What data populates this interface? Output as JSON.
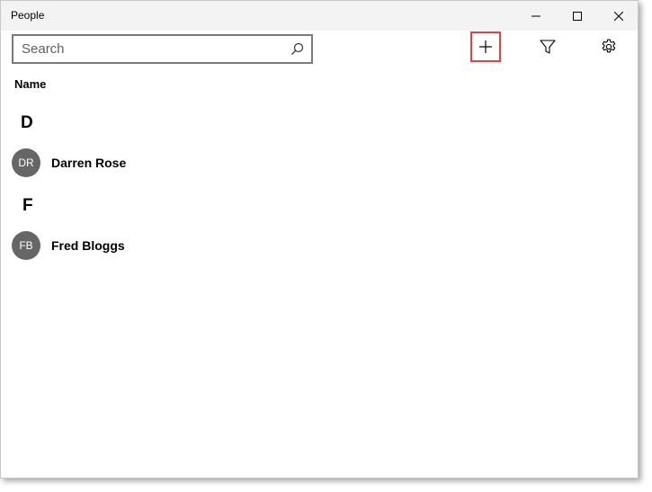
{
  "window": {
    "title": "People"
  },
  "titlebar_buttons": {
    "minimize": "minimize-icon",
    "maximize": "maximize-icon",
    "close": "close-icon"
  },
  "toolbar": {
    "search_placeholder": "Search",
    "search_value": "",
    "add_icon": "plus-icon",
    "filter_icon": "filter-icon",
    "settings_icon": "gear-icon",
    "highlight_color": "#e84040"
  },
  "list": {
    "column_header": "Name",
    "groups": [
      {
        "letter": "D",
        "contacts": [
          {
            "initials": "DR",
            "name": "Darren Rose"
          }
        ]
      },
      {
        "letter": "F",
        "contacts": [
          {
            "initials": "FB",
            "name": "Fred Bloggs"
          }
        ]
      }
    ]
  },
  "colors": {
    "avatar_bg": "#666666",
    "titlebar_bg": "#f3f3f3"
  }
}
